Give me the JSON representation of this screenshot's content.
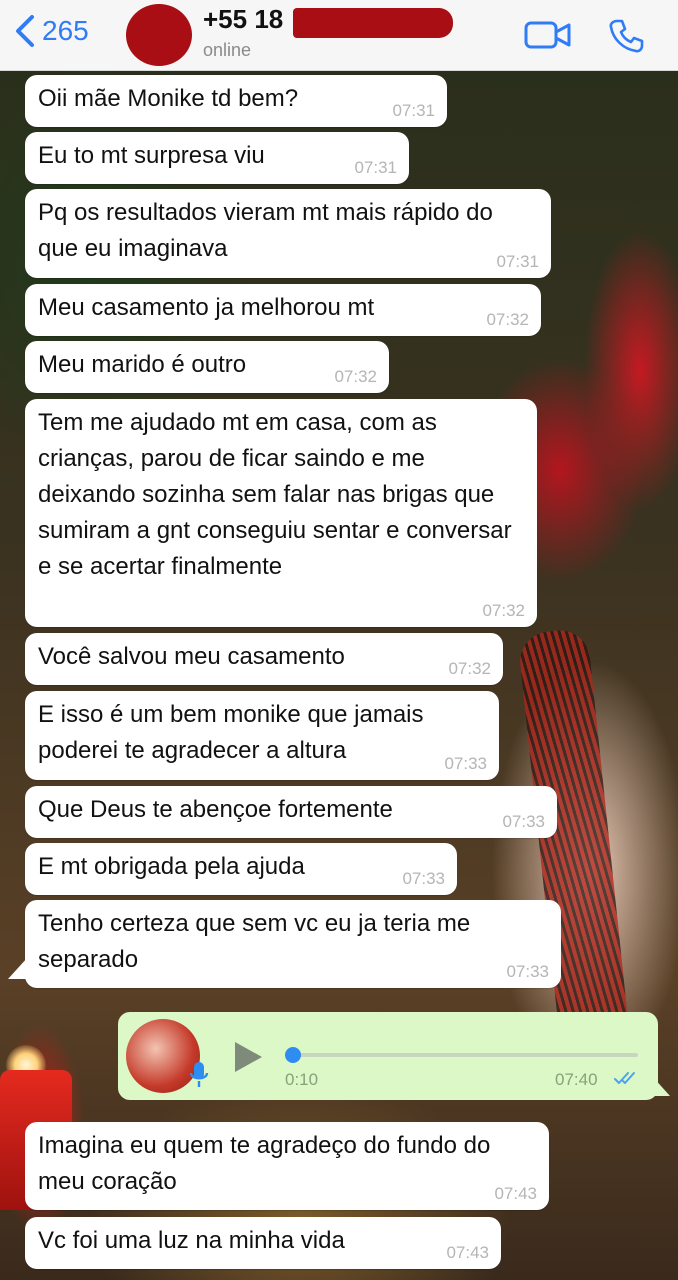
{
  "header": {
    "back_count": "265",
    "contact_number": "+55 18",
    "status": "online"
  },
  "messages": [
    {
      "text": "Oii mãe Monike td bem?",
      "time": "07:31"
    },
    {
      "text": "Eu to mt surpresa viu",
      "time": "07:31"
    },
    {
      "text": "Pq os resultados vieram mt mais rápido do que eu imaginava",
      "time": "07:31"
    },
    {
      "text": "Meu casamento ja melhorou mt",
      "time": "07:32"
    },
    {
      "text": "Meu marido é outro",
      "time": "07:32"
    },
    {
      "text": "Tem me ajudado mt em casa, com as crianças, parou de ficar saindo e me deixando sozinha sem falar nas brigas que sumiram a gnt conseguiu sentar e conversar e se acertar finalmente",
      "time": "07:32"
    },
    {
      "text": "Você salvou meu casamento",
      "time": "07:32"
    },
    {
      "text": "E isso é um bem monike que jamais poderei te agradecer a altura",
      "time": "07:33"
    },
    {
      "text": "Que Deus te abençoe fortemente",
      "time": "07:33"
    },
    {
      "text": "E mt obrigada pela ajuda",
      "time": "07:33"
    },
    {
      "text": "Tenho certeza que sem vc eu ja teria me separado",
      "time": "07:33"
    }
  ],
  "voice_note": {
    "duration": "0:10",
    "time": "07:40",
    "progress": 0,
    "status": "read"
  },
  "replies": [
    {
      "text": "Imagina eu quem te agradeço do fundo do meu coração",
      "time": "07:43"
    },
    {
      "text": "Vc foi uma luz na minha vida",
      "time": "07:43"
    }
  ],
  "colors": {
    "accent": "#2f7cf6",
    "outgoing_bubble": "#dcf8c6",
    "incoming_bubble": "#ffffff",
    "redaction": "#a80e14"
  }
}
